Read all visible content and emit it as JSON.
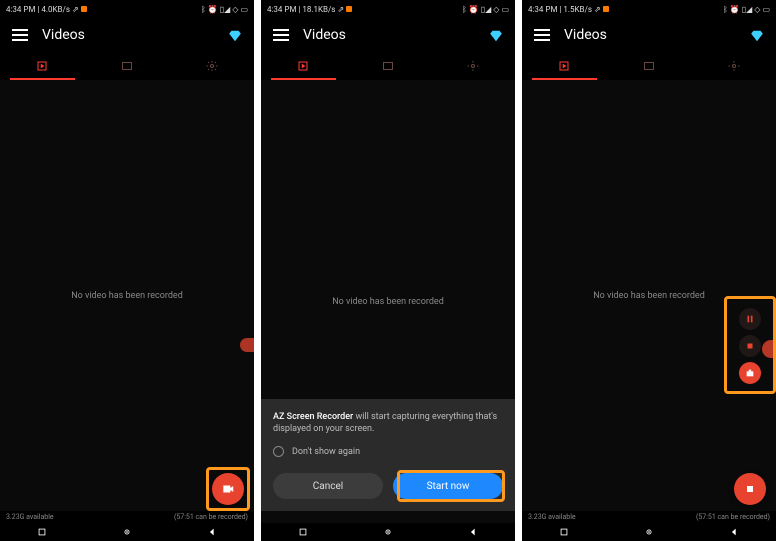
{
  "screens": [
    {
      "status": {
        "time": "4:34 PM",
        "net": "4.0KB/s"
      },
      "header": {
        "title": "Videos"
      },
      "empty": "No video has been recorded",
      "bottom_left": "3.23G available",
      "bottom_right": "(57:51 can be recorded)"
    },
    {
      "status": {
        "time": "4:34 PM",
        "net": "18.1KB/s"
      },
      "header": {
        "title": "Videos"
      },
      "empty": "No video has been recorded",
      "dialog": {
        "app_name": "AZ Screen Recorder",
        "message": " will start capturing everything that's displayed on your screen.",
        "checkbox": "Don't show again",
        "cancel": "Cancel",
        "start": "Start now"
      }
    },
    {
      "status": {
        "time": "4:34 PM",
        "net": "1.5KB/s"
      },
      "header": {
        "title": "Videos"
      },
      "empty": "No video has been recorded",
      "bottom_left": "3.23G available",
      "bottom_right": "(57:51 can be recorded)"
    }
  ]
}
